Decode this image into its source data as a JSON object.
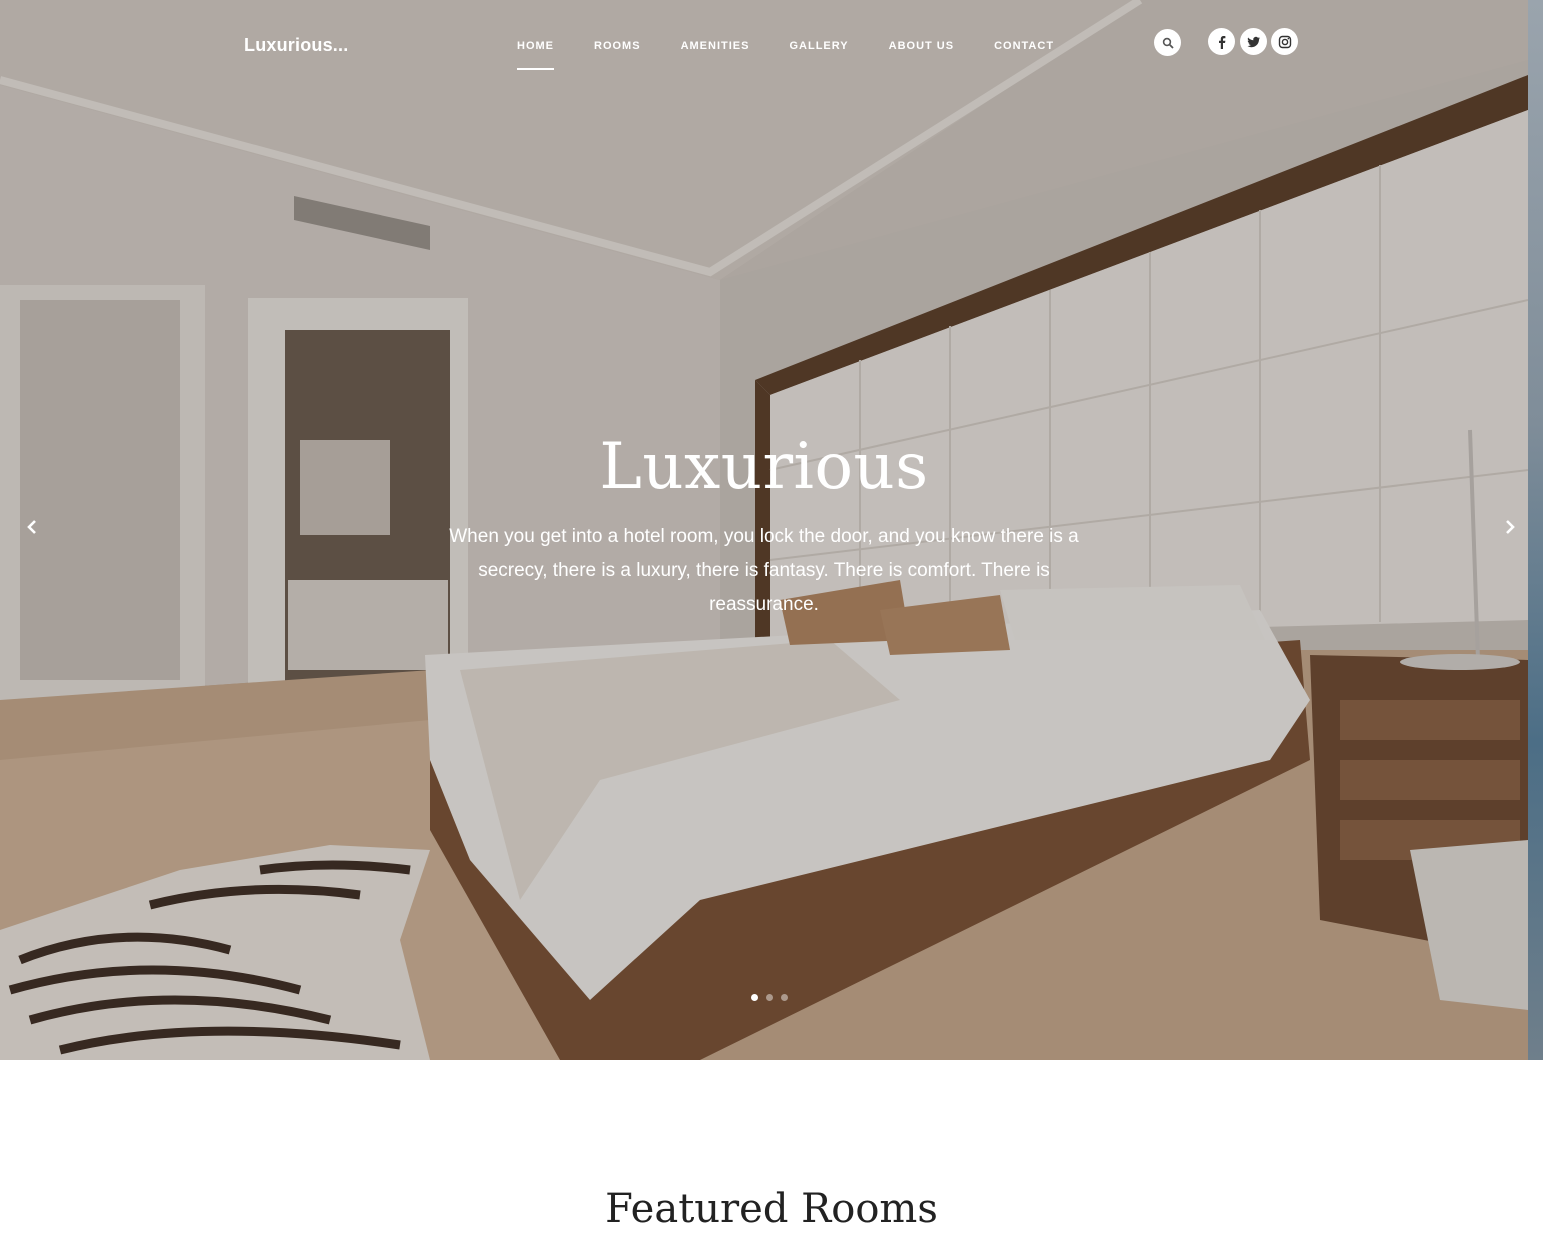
{
  "header": {
    "logo": "Luxurious...",
    "nav": [
      "HOME",
      "ROOMS",
      "AMENITIES",
      "GALLERY",
      "ABOUT US",
      "CONTACT"
    ],
    "active_nav": "HOME",
    "search_icon": "search-icon",
    "social_icons": [
      "facebook-icon",
      "twitter-icon",
      "instagram-icon"
    ]
  },
  "hero": {
    "title": "Luxurious",
    "text": "When you get into a hotel room, you lock the door, and you know there is a secrecy, there is a luxury, there is fantasy. There is comfort. There is reassurance.",
    "prev_icon": "chevron-left-icon",
    "next_icon": "chevron-right-icon",
    "slides": 3,
    "active_slide": 1
  },
  "featured": {
    "title": "Featured Rooms"
  },
  "colors": {
    "text_light": "#ffffff",
    "heading_dark": "#222222"
  }
}
